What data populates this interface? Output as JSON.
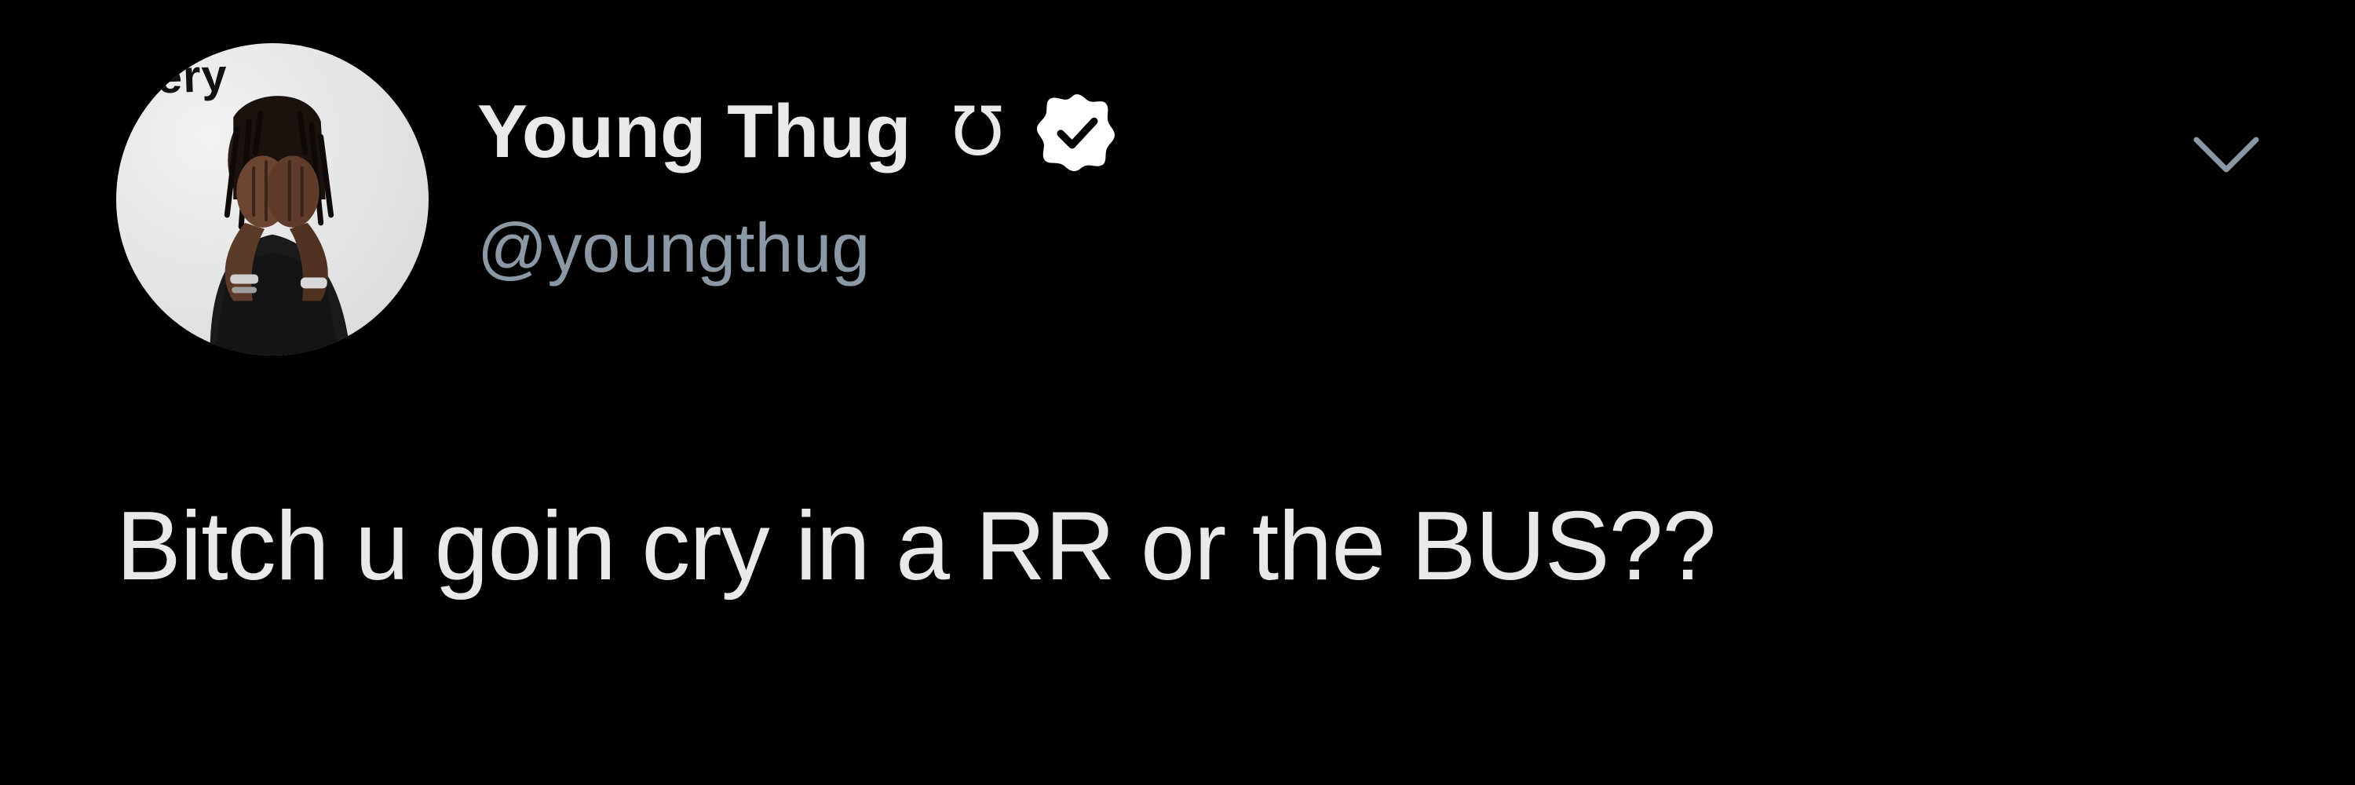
{
  "tweet": {
    "author": {
      "display_name": "Young Thug",
      "name_symbol": "Ʊ",
      "handle": "@youngthug",
      "verified": true,
      "avatar_watermark": "iffery"
    },
    "text": "Bitch u goin cry in a RR or the BUS??",
    "menu_icon": "chevron-down-icon"
  },
  "colors": {
    "background": "#000000",
    "text_primary": "#e7e9ea",
    "text_secondary": "#8b98a5",
    "verified_badge": "#ffffff"
  }
}
